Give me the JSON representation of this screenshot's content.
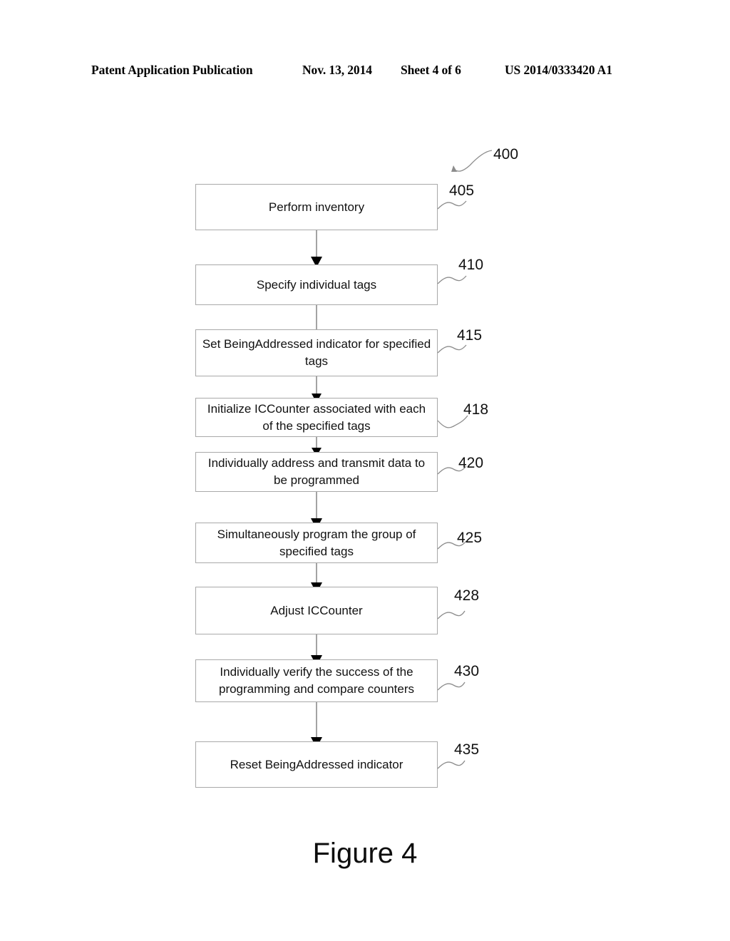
{
  "header": {
    "publication": "Patent Application Publication",
    "date": "Nov. 13, 2014",
    "sheet": "Sheet 4 of 6",
    "patent_number": "US 2014/0333420 A1"
  },
  "figure": {
    "caption": "Figure 4",
    "diagram_label": "400"
  },
  "flowchart": {
    "type": "flowchart",
    "orientation": "top-to-bottom",
    "steps": [
      {
        "ref": "405",
        "text": "Perform inventory"
      },
      {
        "ref": "410",
        "text": "Specify individual tags"
      },
      {
        "ref": "415",
        "text": "Set BeingAddressed indicator for specified tags"
      },
      {
        "ref": "418",
        "text": "Initialize ICCounter associated with each of the specified tags"
      },
      {
        "ref": "420",
        "text": "Individually address and transmit data to be programmed"
      },
      {
        "ref": "425",
        "text": "Simultaneously program the group of specified tags"
      },
      {
        "ref": "428",
        "text": "Adjust ICCounter"
      },
      {
        "ref": "430",
        "text": "Individually verify the success of the programming and compare counters"
      },
      {
        "ref": "435",
        "text": "Reset BeingAddressed indicator"
      }
    ],
    "colors": {
      "box_border": "#a9a9a9",
      "connector_line": "#8c8c8c",
      "arrowhead": "#000000",
      "text": "#111111",
      "background": "#ffffff"
    }
  }
}
